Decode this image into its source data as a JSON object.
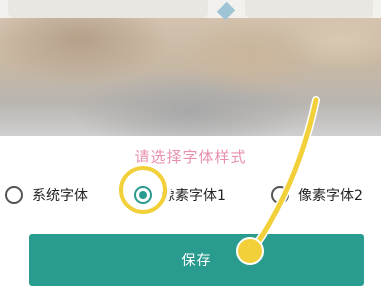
{
  "dialog": {
    "title": "请选择字体样式",
    "options": [
      {
        "label": "系统字体",
        "selected": false
      },
      {
        "label": "像素字体1",
        "selected": true
      },
      {
        "label": "像素字体2",
        "selected": false
      }
    ],
    "save_label": "保存"
  },
  "colors": {
    "accent": "#2a9b8f",
    "title": "#e88fae",
    "gesture": "#f2d03a"
  }
}
